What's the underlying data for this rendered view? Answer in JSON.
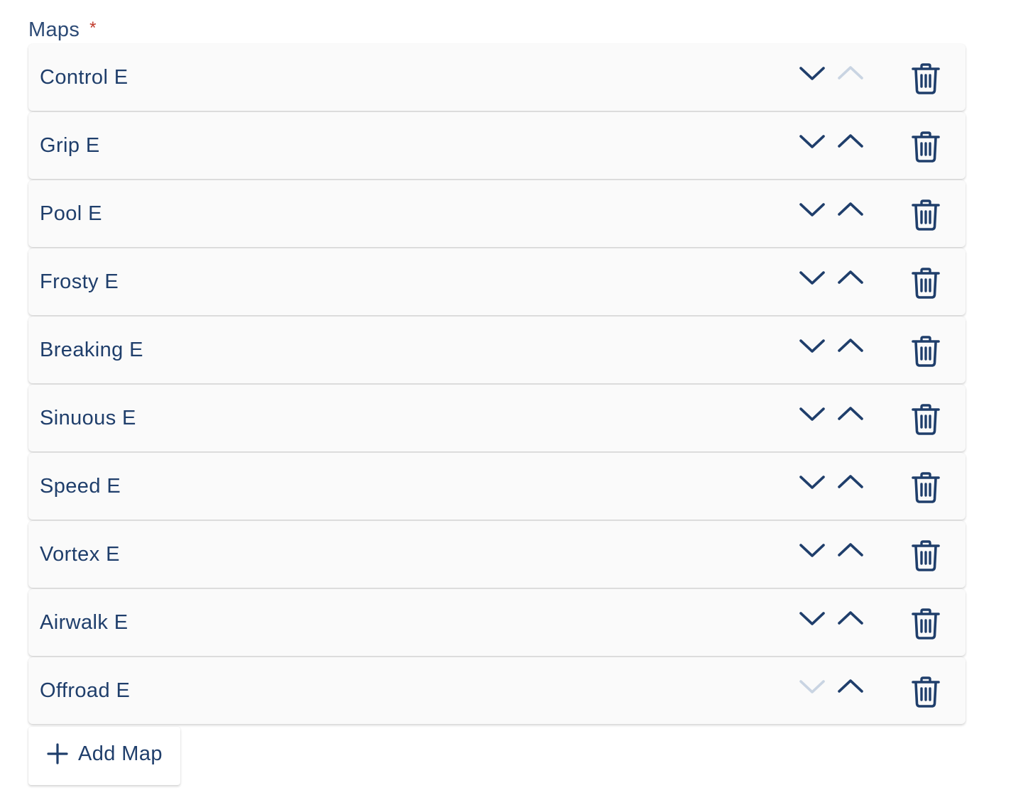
{
  "field": {
    "label": "Maps",
    "required_mark": "*"
  },
  "maps": [
    {
      "name": "Control E",
      "down_enabled": true,
      "up_enabled": false
    },
    {
      "name": "Grip E",
      "down_enabled": true,
      "up_enabled": true
    },
    {
      "name": "Pool E",
      "down_enabled": true,
      "up_enabled": true
    },
    {
      "name": "Frosty E",
      "down_enabled": true,
      "up_enabled": true
    },
    {
      "name": "Breaking E",
      "down_enabled": true,
      "up_enabled": true
    },
    {
      "name": "Sinuous E",
      "down_enabled": true,
      "up_enabled": true
    },
    {
      "name": "Speed E",
      "down_enabled": true,
      "up_enabled": true
    },
    {
      "name": "Vortex E",
      "down_enabled": true,
      "up_enabled": true
    },
    {
      "name": "Airwalk E",
      "down_enabled": true,
      "up_enabled": true
    },
    {
      "name": "Offroad E",
      "down_enabled": false,
      "up_enabled": true
    }
  ],
  "icons": {
    "move_down": "chevron-down-icon",
    "move_up": "chevron-up-icon",
    "delete": "trash-icon",
    "add": "plus-icon"
  },
  "add_button": {
    "label": "Add Map"
  },
  "colors": {
    "text": "#1f3e6b",
    "icon": "#1f3e6b",
    "icon_disabled": "#c9d4e2",
    "required": "#c0392b",
    "item_background": "#fafafa"
  }
}
